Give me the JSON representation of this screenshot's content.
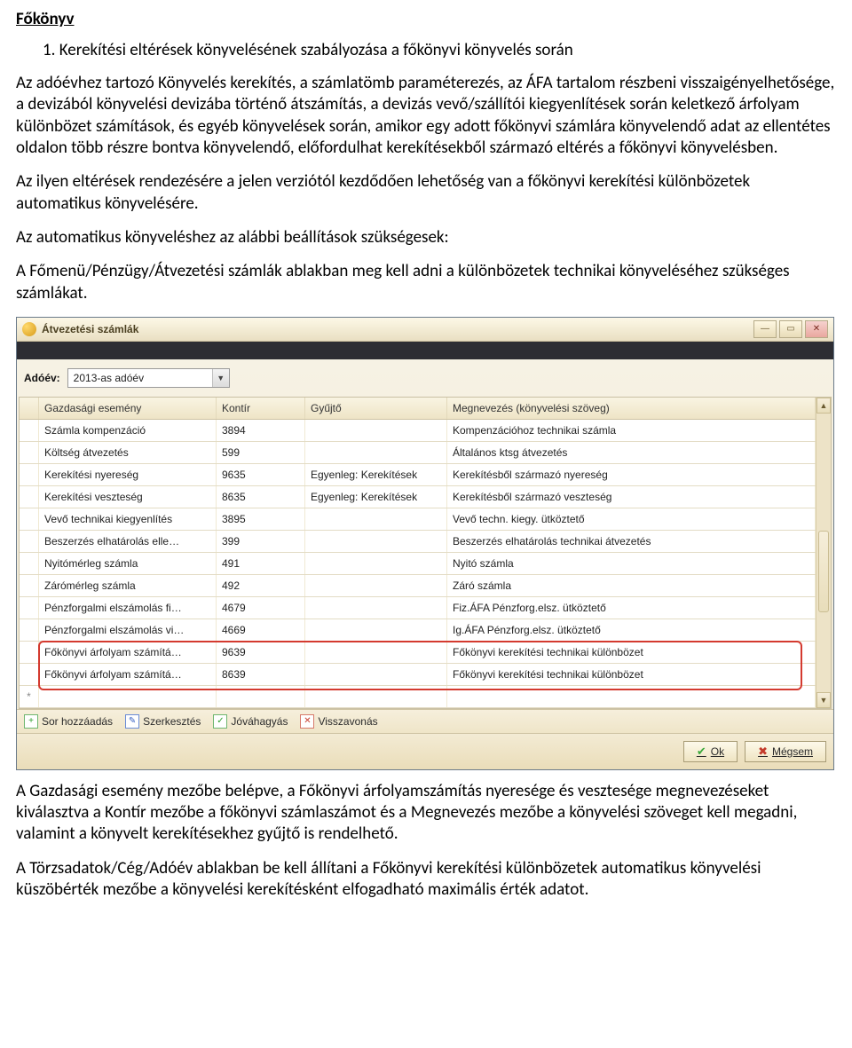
{
  "doc": {
    "heading": "Főkönyv",
    "list_item": "1. Kerekítési eltérések könyvelésének szabályozása a főkönyvi könyvelés során",
    "p1": "Az adóévhez tartozó Könyvelés kerekítés, a számlatömb paraméterezés, az ÁFA tartalom részbeni visszaigényelhetősége, a devizából könyvelési devizába történő átszámítás, a devizás vevő/szállítói kiegyenlítések során keletkező árfolyam különbözet számítások, és egyéb könyvelések során, amikor egy adott főkönyvi számlára könyvelendő adat az ellentétes oldalon több részre bontva könyvelendő, előfordulhat kerekítésekből származó eltérés a főkönyvi könyvelésben.",
    "p2": "Az ilyen eltérések rendezésére a jelen verziótól kezdődően lehetőség van a főkönyvi kerekítési különbözetek automatikus könyvelésére.",
    "p3": "Az automatikus könyveléshez az alábbi beállítások szükségesek:",
    "p4": "A Főmenü/Pénzügy/Átvezetési számlák ablakban meg kell adni a különbözetek technikai könyveléséhez szükséges számlákat.",
    "p5": "A Gazdasági esemény mezőbe belépve, a Főkönyvi árfolyamszámítás nyeresége és vesztesége megnevezéseket kiválasztva a Kontír mezőbe a főkönyvi számlaszámot és a Megnevezés mezőbe a könyvelési szöveget kell megadni, valamint a könyvelt kerekítésekhez gyűjtő is rendelhető.",
    "p6": "A Törzsadatok/Cég/Adóév ablakban be kell állítani a Főkönyvi kerekítési különbözetek automatikus könyvelési küszöbérték mezőbe a könyvelési kerekítésként elfogadható maximális érték adatot."
  },
  "window": {
    "title": "Átvezetési számlák",
    "adoev_label": "Adóév:",
    "adoev_value": "2013-as adóév",
    "columns": {
      "event": "Gazdasági esemény",
      "kontir": "Kontír",
      "gyujto": "Gyűjtő",
      "megnev": "Megnevezés (könyvelési szöveg)"
    },
    "rows": [
      {
        "event": "Számla kompenzáció",
        "kontir": "3894",
        "gyujto": "",
        "megnev": "Kompenzációhoz technikai számla"
      },
      {
        "event": "Költség átvezetés",
        "kontir": "599",
        "gyujto": "",
        "megnev": "Általános ktsg átvezetés"
      },
      {
        "event": "Kerekítési nyereség",
        "kontir": "9635",
        "gyujto": "Egyenleg: Kerekítések",
        "megnev": "Kerekítésből származó nyereség"
      },
      {
        "event": "Kerekítési veszteség",
        "kontir": "8635",
        "gyujto": "Egyenleg: Kerekítések",
        "megnev": "Kerekítésből származó veszteség"
      },
      {
        "event": "Vevő technikai kiegyenlítés",
        "kontir": "3895",
        "gyujto": "",
        "megnev": "Vevő techn. kiegy. ütköztető"
      },
      {
        "event": "Beszerzés elhatárolás elle…",
        "kontir": "399",
        "gyujto": "",
        "megnev": "Beszerzés elhatárolás technikai átvezetés"
      },
      {
        "event": "Nyitómérleg számla",
        "kontir": "491",
        "gyujto": "",
        "megnev": "Nyitó számla"
      },
      {
        "event": "Zárómérleg számla",
        "kontir": "492",
        "gyujto": "",
        "megnev": "Záró számla"
      },
      {
        "event": "Pénzforgalmi elszámolás fi…",
        "kontir": "4679",
        "gyujto": "",
        "megnev": "Fiz.ÁFA Pénzforg.elsz. ütköztető"
      },
      {
        "event": "Pénzforgalmi elszámolás vi…",
        "kontir": "4669",
        "gyujto": "",
        "megnev": "Ig.ÁFA Pénzforg.elsz. ütköztető"
      },
      {
        "event": "Főkönyvi árfolyam számítá…",
        "kontir": "9639",
        "gyujto": "",
        "megnev": "Főkönyvi kerekítési technikai különbözet"
      },
      {
        "event": "Főkönyvi árfolyam számítá…",
        "kontir": "8639",
        "gyujto": "",
        "megnev": "Főkönyvi kerekítési technikai különbözet"
      }
    ],
    "newrow_marker": "*",
    "toolbar": {
      "add": "Sor hozzáadás",
      "edit": "Szerkesztés",
      "approve": "Jóváhagyás",
      "revoke": "Visszavonás"
    },
    "buttons": {
      "ok": "Ok",
      "cancel": "Mégsem"
    }
  }
}
